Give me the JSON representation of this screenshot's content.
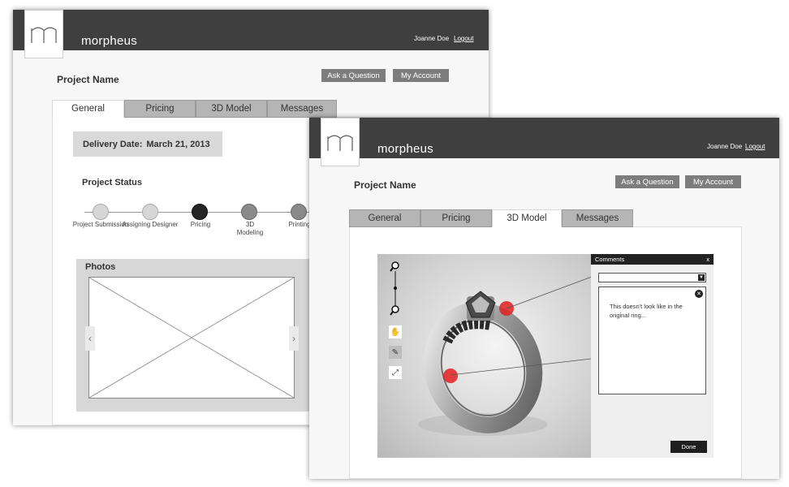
{
  "brand": {
    "name": "morpheus",
    "logo_letter": "m"
  },
  "user": {
    "name": "Joanne Doe",
    "logout_label": "Logout"
  },
  "project": {
    "title": "Project Name"
  },
  "actions": {
    "ask_label": "Ask a Question",
    "account_label": "My Account"
  },
  "tabs": [
    {
      "label": "General"
    },
    {
      "label": "Pricing"
    },
    {
      "label": "3D Model"
    },
    {
      "label": "Messages"
    }
  ],
  "general": {
    "delivery_label": "Delivery Date:",
    "delivery_value": "March 21, 2013",
    "status_title": "Project Status",
    "steps": [
      {
        "label": "Project Submission",
        "state": "done"
      },
      {
        "label": "Assigning Designer",
        "state": "done"
      },
      {
        "label": "Pricing",
        "state": "current"
      },
      {
        "label": "3D Modeling",
        "state": "pending"
      },
      {
        "label": "Printing",
        "state": "pending"
      }
    ],
    "photos_title": "Photos",
    "prev_arrow": "‹",
    "next_arrow": "›"
  },
  "model": {
    "tools": [
      "zoom-in-icon",
      "zoom-out-icon",
      "hand-icon",
      "pencil-icon",
      "fullscreen-icon"
    ],
    "comments": {
      "title": "Comments",
      "close_label": "x",
      "text": "This doesn't look like in the original ring...",
      "done_label": "Done"
    }
  },
  "colors": {
    "header": "#3f3f3f",
    "marker": "#e02020",
    "button": "#7d7d7d"
  }
}
